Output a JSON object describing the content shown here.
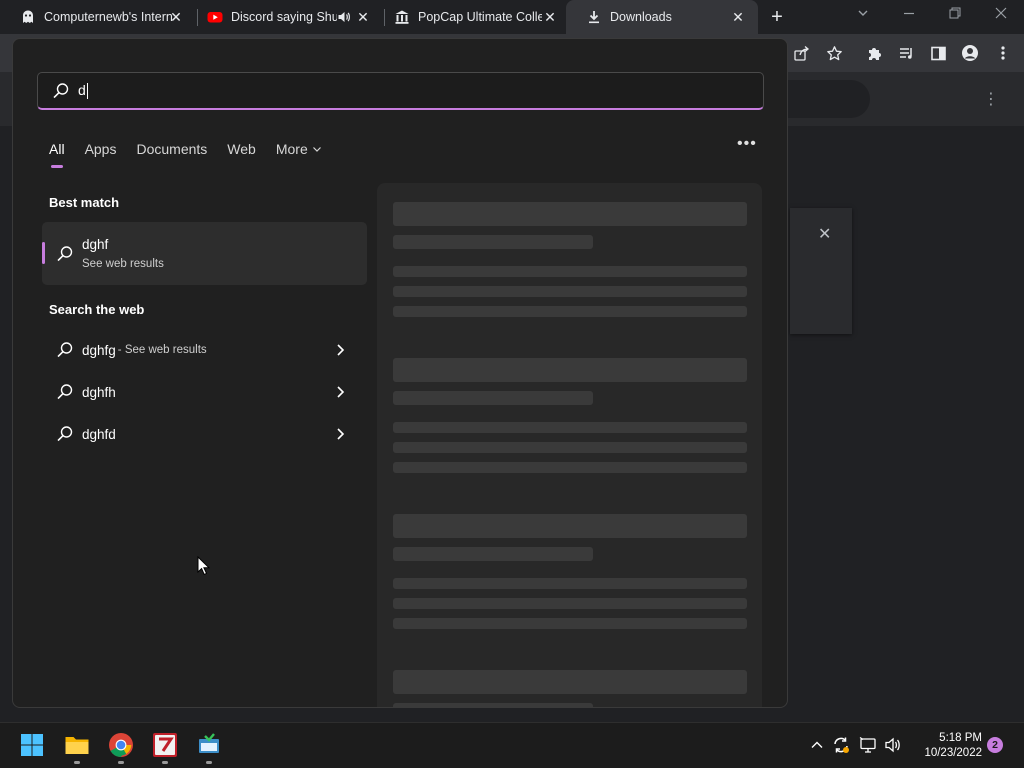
{
  "browser": {
    "tabs": [
      {
        "title": "Computernewb's Intern",
        "favicon": "ghost-icon",
        "close": "✕"
      },
      {
        "title": "Discord saying Shu",
        "favicon": "youtube-icon",
        "audio": "speaker-icon",
        "close": "✕"
      },
      {
        "title": "PopCap Ultimate Colle",
        "favicon": "archive-icon",
        "close": "✕"
      },
      {
        "title": "Downloads",
        "favicon": "download-icon",
        "close": "✕"
      }
    ],
    "new_tab": "+",
    "content_close": "✕",
    "content_menu": "⋮"
  },
  "search": {
    "query": "d",
    "filters": [
      {
        "label": "All",
        "active": true
      },
      {
        "label": "Apps"
      },
      {
        "label": "Documents"
      },
      {
        "label": "Web"
      },
      {
        "label": "More"
      }
    ],
    "more_options": "•••",
    "best_match": {
      "heading": "Best match",
      "name": "dghf",
      "sub": "See web results"
    },
    "web": {
      "heading": "Search the web",
      "items": [
        {
          "label": "dghfg",
          "hint": "- See web results"
        },
        {
          "label": "dghfh",
          "hint": ""
        },
        {
          "label": "dghfd",
          "hint": ""
        }
      ]
    }
  },
  "taskbar": {
    "time": "5:18 PM",
    "date": "10/23/2022",
    "notifications": "2"
  },
  "colors": {
    "accent": "#c77dde",
    "flyout_bg": "#202020",
    "taskbar_bg": "#1c1c1c"
  }
}
